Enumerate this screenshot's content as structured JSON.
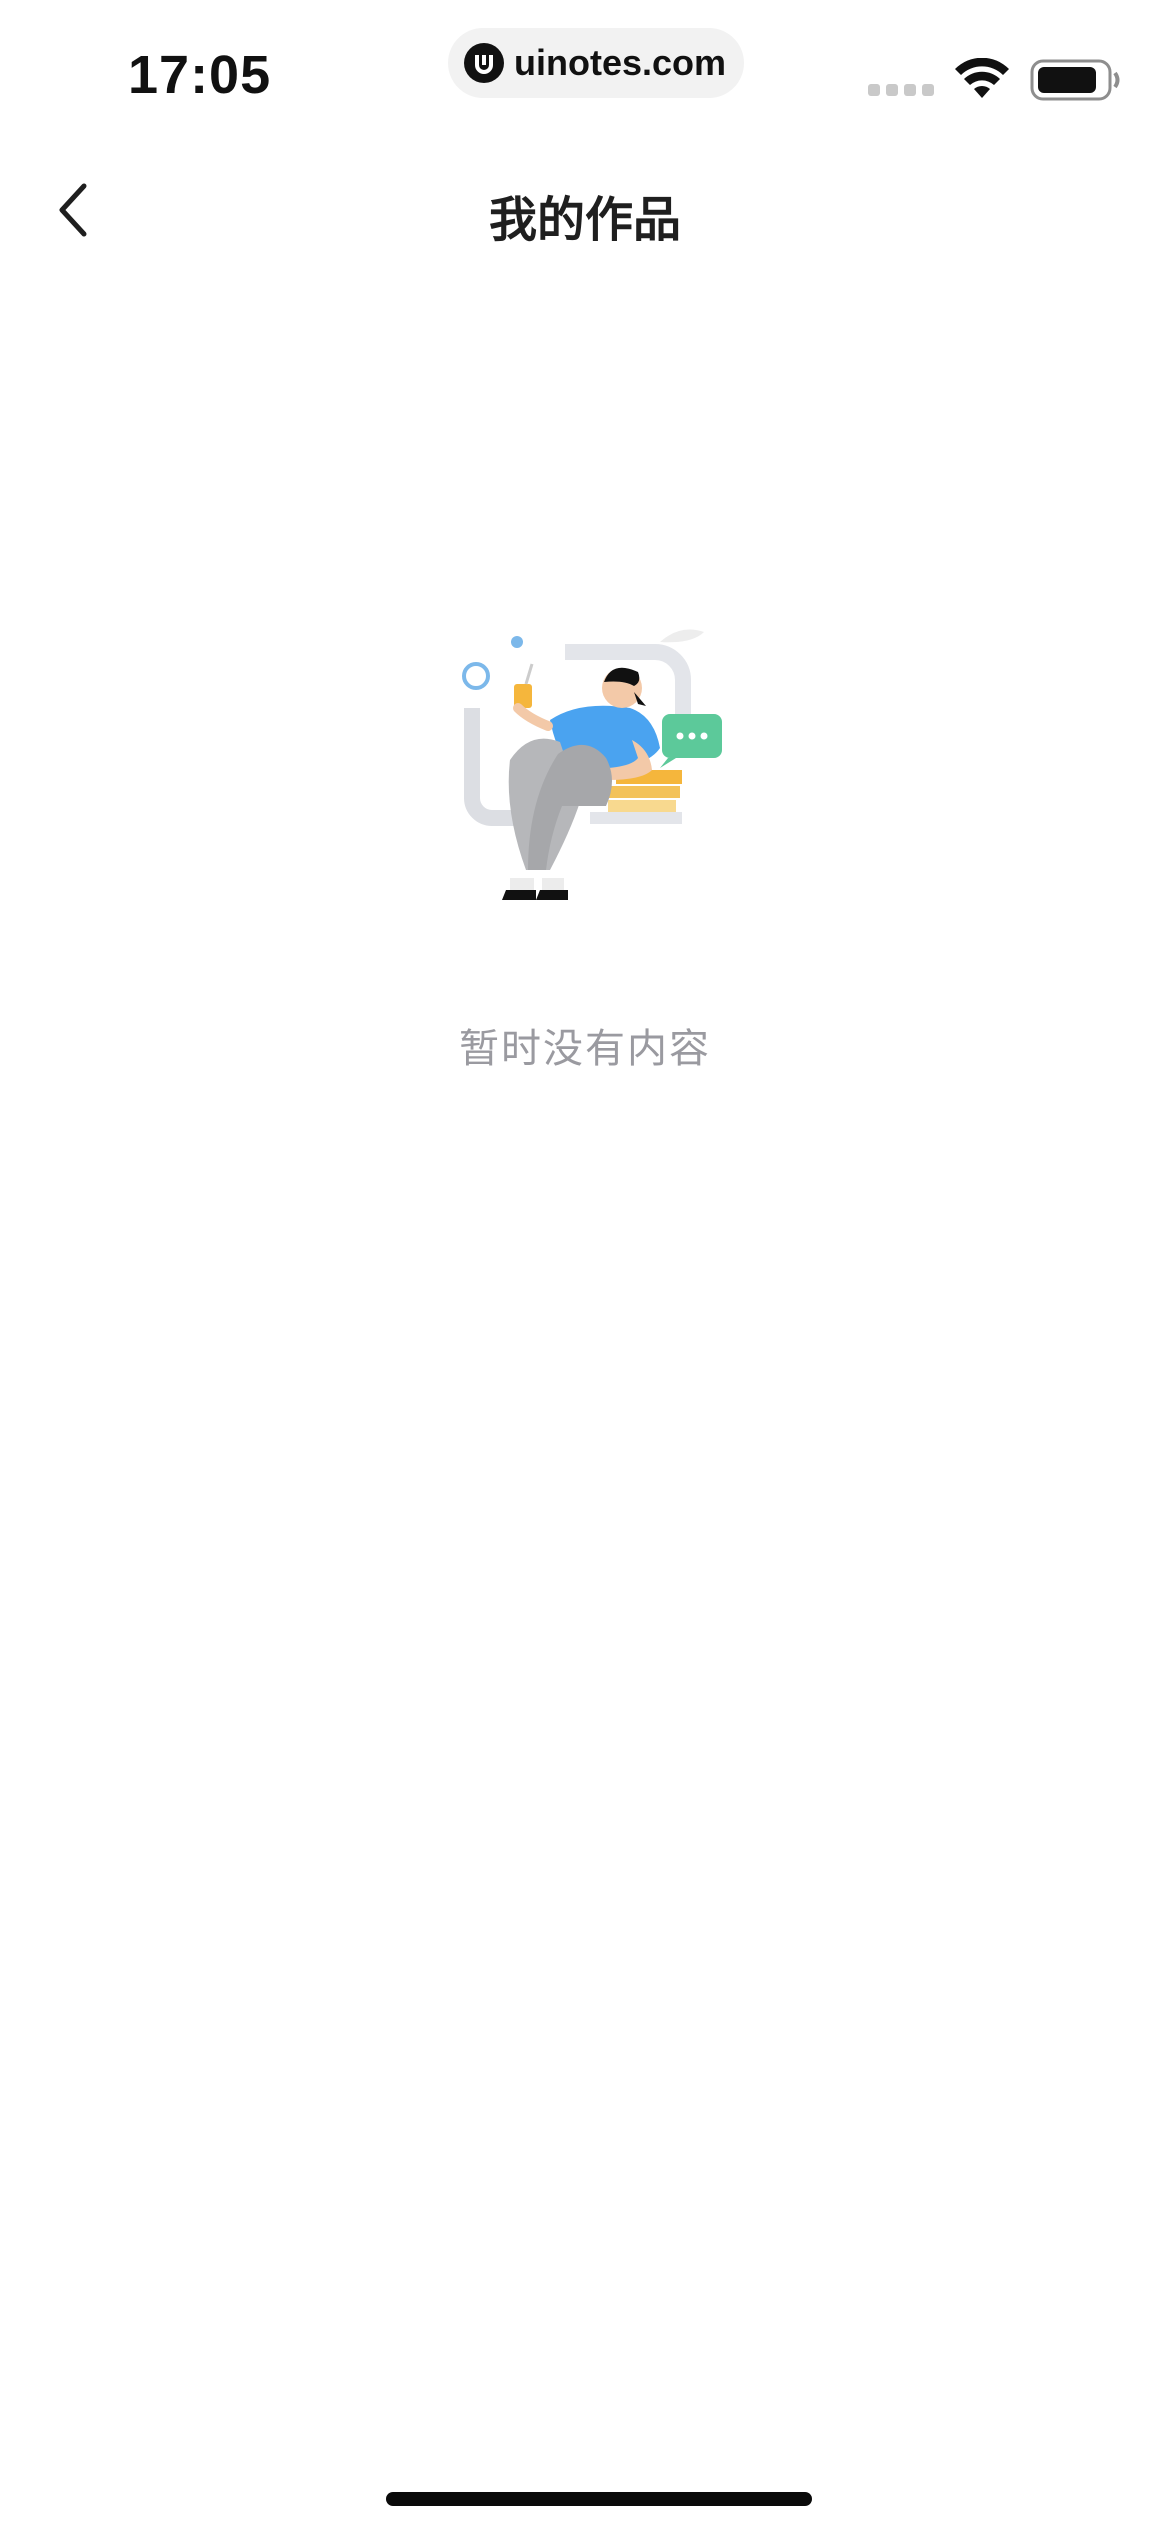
{
  "status_bar": {
    "time": "17:05",
    "url": "uinotes.com",
    "icons": [
      "cellular-signal-icon",
      "wifi-icon",
      "battery-icon"
    ]
  },
  "nav": {
    "back_icon": "chevron-left-icon",
    "title": "我的作品"
  },
  "empty_state": {
    "illustration": "person-reading-empty-illustration",
    "message": "暂时没有内容"
  },
  "colors": {
    "text_primary": "#1f1f1f",
    "text_secondary": "#9a9aa0",
    "accent_blue": "#4aa3f0",
    "accent_green": "#5cc99a",
    "accent_yellow": "#f5b63c"
  }
}
